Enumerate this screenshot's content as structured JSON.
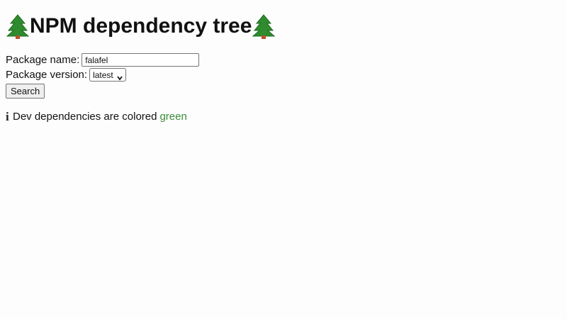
{
  "header": {
    "title": "NPM dependency tree",
    "left_icon": "tree-icon",
    "right_icon": "tree-icon"
  },
  "form": {
    "package_name_label": "Package name:",
    "package_name_value": "falafel",
    "package_version_label": "Package version:",
    "package_version_selected": "latest",
    "search_label": "Search"
  },
  "info": {
    "icon": "info-icon",
    "text": "Dev dependencies are colored",
    "highlight": "green",
    "highlight_color": "#3a8a3a"
  }
}
